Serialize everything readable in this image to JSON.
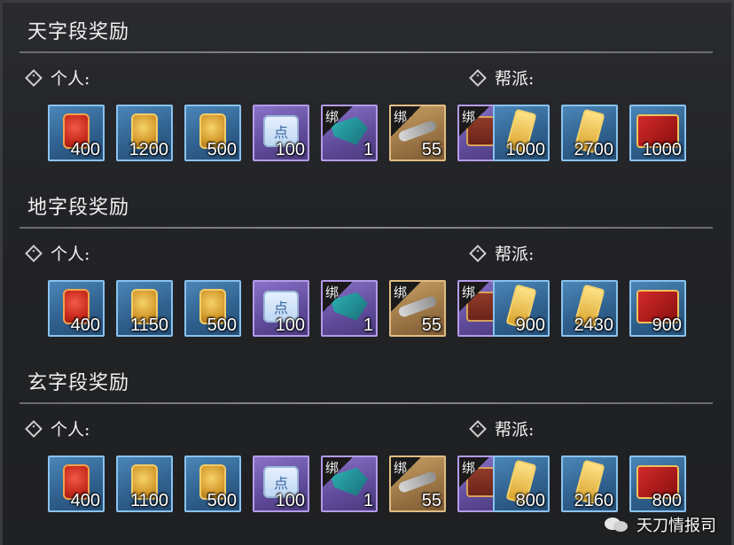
{
  "sections": [
    {
      "title": "天字段奖励",
      "personal_label": "个人:",
      "guild_label": "帮派:",
      "personal_items": [
        {
          "icon": "red-token-icon",
          "count": "400",
          "frame": "blue"
        },
        {
          "icon": "gold-token-icon",
          "count": "1200",
          "frame": "blue"
        },
        {
          "icon": "gold-token-icon",
          "count": "500",
          "frame": "blue"
        },
        {
          "icon": "scroll-icon",
          "count": "100",
          "frame": "purple"
        },
        {
          "icon": "fan-icon",
          "count": "1",
          "frame": "purple",
          "bind": "绑"
        },
        {
          "icon": "key-icon",
          "count": "55",
          "frame": "gold",
          "bind": "绑"
        }
      ],
      "guild_items": [
        {
          "icon": "chest-icon",
          "count": "",
          "frame": "purple",
          "bind": "绑"
        },
        {
          "icon": "gold-slip-icon",
          "count": "1000",
          "frame": "blue"
        },
        {
          "icon": "gold-slip-icon",
          "count": "2700",
          "frame": "blue"
        },
        {
          "icon": "red-book-icon",
          "count": "1000",
          "frame": "blue"
        }
      ]
    },
    {
      "title": "地字段奖励",
      "personal_label": "个人:",
      "guild_label": "帮派:",
      "personal_items": [
        {
          "icon": "red-token-icon",
          "count": "400",
          "frame": "blue"
        },
        {
          "icon": "gold-token-icon",
          "count": "1150",
          "frame": "blue"
        },
        {
          "icon": "gold-token-icon",
          "count": "500",
          "frame": "blue"
        },
        {
          "icon": "scroll-icon",
          "count": "100",
          "frame": "purple"
        },
        {
          "icon": "fan-icon",
          "count": "1",
          "frame": "purple",
          "bind": "绑"
        },
        {
          "icon": "key-icon",
          "count": "55",
          "frame": "gold",
          "bind": "绑"
        }
      ],
      "guild_items": [
        {
          "icon": "chest-icon",
          "count": "",
          "frame": "purple",
          "bind": "绑"
        },
        {
          "icon": "gold-slip-icon",
          "count": "900",
          "frame": "blue"
        },
        {
          "icon": "gold-slip-icon",
          "count": "2430",
          "frame": "blue"
        },
        {
          "icon": "red-book-icon",
          "count": "900",
          "frame": "blue"
        }
      ]
    },
    {
      "title": "玄字段奖励",
      "personal_label": "个人:",
      "guild_label": "帮派:",
      "personal_items": [
        {
          "icon": "red-token-icon",
          "count": "400",
          "frame": "blue"
        },
        {
          "icon": "gold-token-icon",
          "count": "1100",
          "frame": "blue"
        },
        {
          "icon": "gold-token-icon",
          "count": "500",
          "frame": "blue"
        },
        {
          "icon": "scroll-icon",
          "count": "100",
          "frame": "purple"
        },
        {
          "icon": "fan-icon",
          "count": "1",
          "frame": "purple",
          "bind": "绑"
        },
        {
          "icon": "key-icon",
          "count": "55",
          "frame": "gold",
          "bind": "绑"
        }
      ],
      "guild_items": [
        {
          "icon": "chest-icon",
          "count": "",
          "frame": "purple",
          "bind": "绑"
        },
        {
          "icon": "gold-slip-icon",
          "count": "800",
          "frame": "blue"
        },
        {
          "icon": "gold-slip-icon",
          "count": "2160",
          "frame": "blue"
        },
        {
          "icon": "red-book-icon",
          "count": "800",
          "frame": "blue"
        }
      ]
    }
  ],
  "watermark": "天刀情报司"
}
